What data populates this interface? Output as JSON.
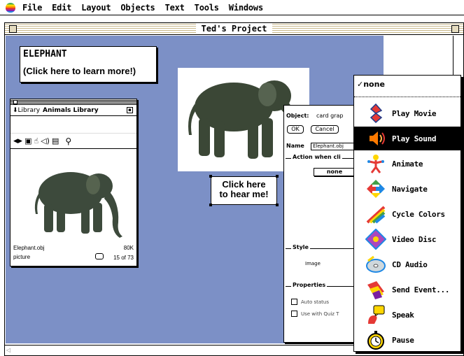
{
  "menubar": {
    "items": [
      "File",
      "Edit",
      "Layout",
      "Objects",
      "Text",
      "Tools",
      "Windows"
    ]
  },
  "window": {
    "title": "Ted's Project"
  },
  "caption_card": {
    "line1": "ELEPHANT",
    "line2": "(Click here to learn more!)"
  },
  "library": {
    "label": "Library",
    "name": "Animals Library",
    "filename": "Elephant.obj",
    "size": "80K",
    "type": "picture",
    "count": "15 of 73"
  },
  "hear_button": {
    "line1": "Click here",
    "line2": "to hear me!"
  },
  "object_dialog": {
    "object_label": "Object:",
    "object_value": "card grap",
    "ok_label": "OK",
    "cancel_label": "Cancel",
    "name_label": "Name",
    "name_value": "Elephant.obj",
    "action_label": "Action when cli",
    "action_value": "none",
    "style_label": "Style",
    "style_value": "Image",
    "properties_label": "Properties",
    "prop1": "Auto status",
    "prop2": "Use with Quiz T"
  },
  "action_menu": {
    "none_label": "none",
    "checked": "none",
    "selected": "Play Sound",
    "items": [
      {
        "label": "Play Movie",
        "icon": "movie-icon"
      },
      {
        "label": "Play Sound",
        "icon": "speaker-icon"
      },
      {
        "label": "Animate",
        "icon": "animate-icon"
      },
      {
        "label": "Navigate",
        "icon": "navigate-arrows-icon"
      },
      {
        "label": "Cycle Colors",
        "icon": "rainbow-icon"
      },
      {
        "label": "Video Disc",
        "icon": "video-disc-icon"
      },
      {
        "label": "CD Audio",
        "icon": "cd-icon"
      },
      {
        "label": "Send Event...",
        "icon": "send-event-icon"
      },
      {
        "label": "Speak",
        "icon": "speech-icon"
      },
      {
        "label": "Pause",
        "icon": "stopwatch-icon"
      }
    ]
  },
  "colors": {
    "canvas": "#7c90c6",
    "selection": "#000000"
  }
}
